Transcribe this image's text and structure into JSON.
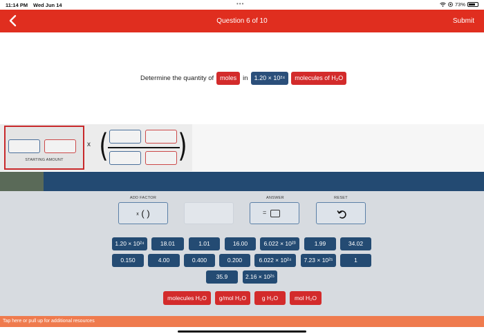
{
  "status_bar": {
    "time": "11:14 PM",
    "date": "Wed Jun 14",
    "battery": "73%",
    "battery_level": 0.73
  },
  "header": {
    "title": "Question 6 of 10",
    "submit_label": "Submit",
    "accent": "#e02e1f"
  },
  "question": {
    "prefix": "Determine the quantity of",
    "target_unit": "moles",
    "connector": "in",
    "given_value": "1.20 × 10²⁴",
    "given_unit": "molecules of H₂O"
  },
  "workspace": {
    "starting_amount_label": "STARTING AMOUNT",
    "multiply_sign": "x"
  },
  "progress": {
    "fraction": 0.09
  },
  "controls": {
    "add_factor_label": "ADD FACTOR",
    "answer_label": "ANSWER",
    "reset_label": "RESET",
    "add_factor_symbol": "( )",
    "add_factor_prefix": "x",
    "answer_prefix": "="
  },
  "number_tiles": {
    "row1": [
      "1.20 × 10²⁴",
      "18.01",
      "1.01",
      "16.00",
      "6.022 × 10²³",
      "1.99",
      "34.02"
    ],
    "row2": [
      "0.150",
      "4.00",
      "0.400",
      "0.200",
      "6.022 × 10²⁴",
      "7.23 × 10²⁵",
      "1"
    ],
    "row3": [
      "35.9",
      "2.16 × 10²⁵"
    ]
  },
  "unit_tiles": [
    "molecules H₂O",
    "g/mol H₂O",
    "g H₂O",
    "mol H₂O"
  ],
  "resources_bar": {
    "text": "Tap here or pull up for additional resources"
  }
}
